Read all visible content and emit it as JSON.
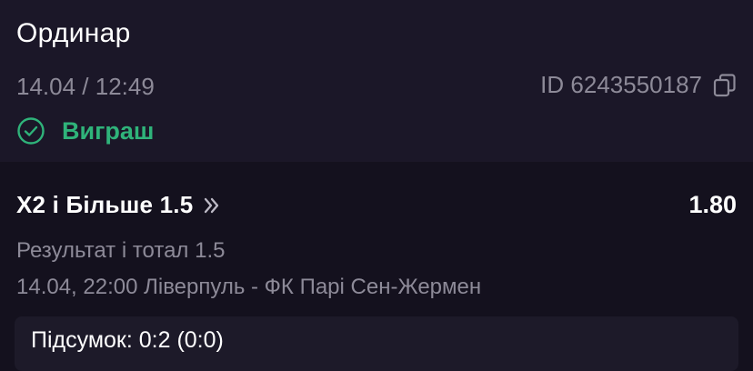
{
  "header": {
    "bet_type": "Ординар",
    "date_time": "14.04 / 12:49",
    "bet_id": "ID 6243550187",
    "status": "Виграш",
    "status_color": "#2fb37a"
  },
  "selection": {
    "name": "X2 і Більше 1.5",
    "odds": "1.80",
    "market": "Результат і тотал 1.5",
    "event": "14.04, 22:00 Ліверпуль - ФК Парі Сен-Жермен",
    "result": "Підсумок: 0:2 (0:0)"
  },
  "icons": {
    "copy": "copy-icon",
    "status": "check-circle-icon",
    "details": "double-chevron-right-icon"
  }
}
